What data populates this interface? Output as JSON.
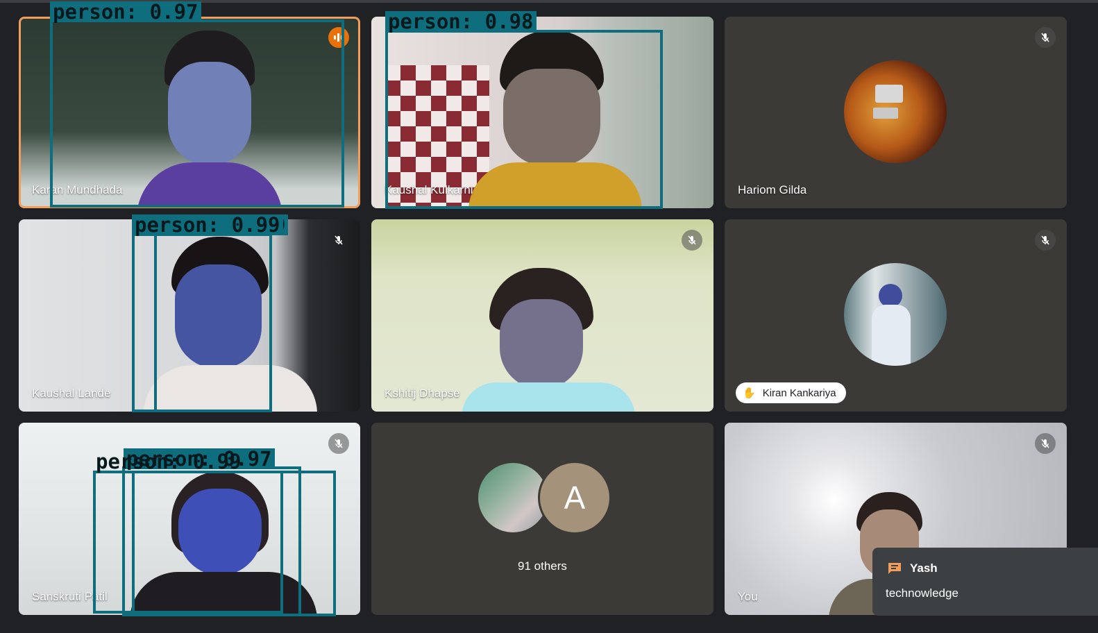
{
  "tiles": [
    {
      "name": "Karan Mundhada",
      "detection": "person: 0.97"
    },
    {
      "name": "Kaushal Kulkarni",
      "detection": "person: 0.98"
    },
    {
      "name": "Hariom Gilda"
    },
    {
      "name": "Kaushal Lande",
      "detection": "person: 0.99",
      "detection_extra": "9"
    },
    {
      "name": "Kshitij Dhapse"
    },
    {
      "name": "Kiran Kankariya",
      "hand_raised": true
    },
    {
      "name": "Sanskruti Patil",
      "detection": "person: 0.99",
      "detection_behind": "person: 0.97"
    },
    {
      "name": "91 others",
      "avatar_letter": "A"
    },
    {
      "name": "You"
    }
  ],
  "chat": {
    "sender": "Yash",
    "message": "technowledge"
  },
  "colors": {
    "tile_bg": "#3c3a37",
    "speaking_border": "#f29d5a",
    "detection_box": "#0f6e7e",
    "page_bg": "#202124"
  },
  "icons": [
    "mic-off-icon",
    "speaking-indicator-icon",
    "hand-raise-icon",
    "chat-icon"
  ]
}
